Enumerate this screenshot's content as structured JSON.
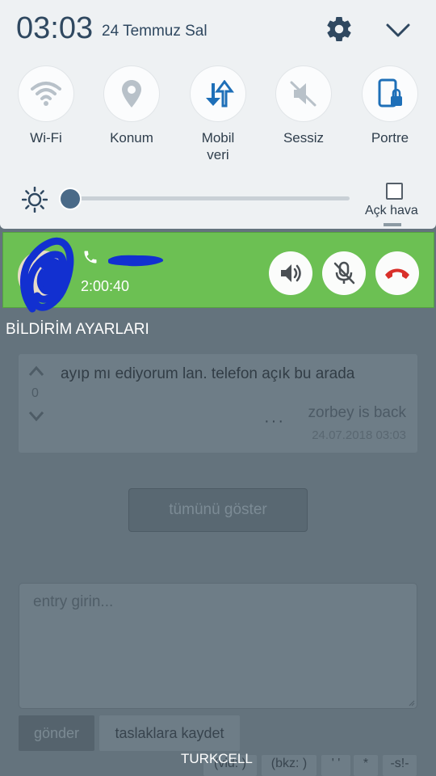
{
  "status": {
    "clock": "03:03",
    "date": "24 Temmuz Sal"
  },
  "icons": {
    "settings": "gear-icon",
    "collapse": "chevron-down-icon",
    "brightness": "sun-icon"
  },
  "quick_tiles": [
    {
      "label": "Wi-Fi",
      "icon": "wifi-icon",
      "state": "off"
    },
    {
      "label": "Konum",
      "icon": "location-icon",
      "state": "off"
    },
    {
      "label": "Mobil\nveri",
      "icon": "mobile-data-icon",
      "state": "on"
    },
    {
      "label": "Sessiz",
      "icon": "mute-icon",
      "state": "off"
    },
    {
      "label": "Portre",
      "icon": "portrait-lock-icon",
      "state": "on"
    }
  ],
  "brightness": {
    "level_fraction": 0.0,
    "auto_label": "Açk hava",
    "auto_checked": false
  },
  "call": {
    "timer": "2:00:40",
    "background": "#6cc053",
    "buttons": [
      "speaker-icon",
      "mute-mic-icon",
      "end-call-icon"
    ]
  },
  "notification_settings": "BİLDİRİM AYARLARI",
  "entry": {
    "vote_count": "0",
    "text": "ayıp mı ediyorum lan. telefon açık bu arada",
    "dots": "···",
    "author": "zorbey is back",
    "date": "24.07.2018 03:03"
  },
  "show_all": "tümünü göster",
  "entry_box": {
    "placeholder": "entry girin..."
  },
  "buttons": {
    "send": "gönder",
    "draft": "taslaklara kaydet"
  },
  "toolbar": [
    "(vid: )",
    "(bkz: )",
    "' '",
    "*",
    "-s!-"
  ],
  "carrier": "TURKCELL",
  "colors": {
    "accent": "#2f4860",
    "page_dim": "#64737d"
  }
}
